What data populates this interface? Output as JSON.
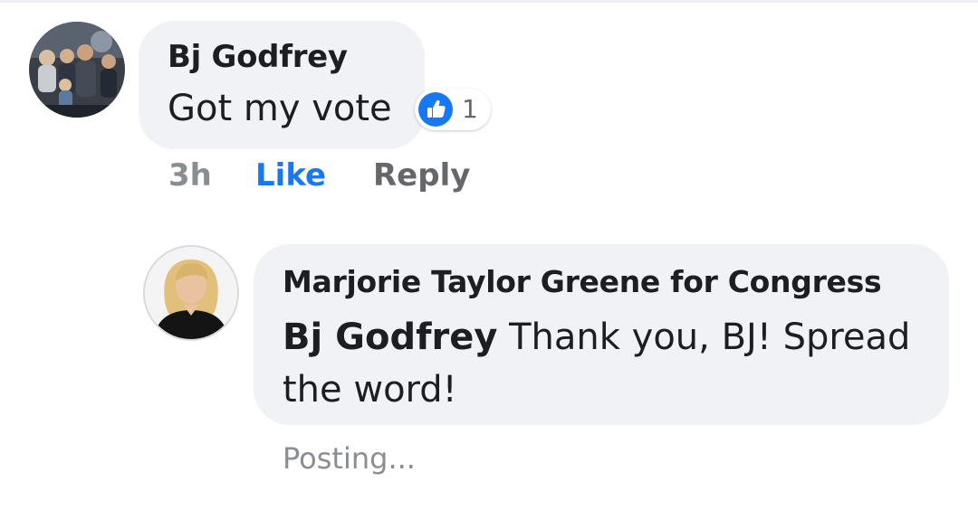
{
  "comments": [
    {
      "author": "Bj Godfrey",
      "text": "Got my vote",
      "reaction_count": "1",
      "reaction_icon": "like-icon",
      "time": "3h",
      "actions": {
        "like_label": "Like",
        "reply_label": "Reply"
      }
    }
  ],
  "reply": {
    "author": "Marjorie Taylor Greene for Congress",
    "mention": "Bj Godfrey",
    "text": "Thank you, BJ! Spread the word!",
    "status": "Posting..."
  },
  "colors": {
    "accent_blue": "#1877f2",
    "bubble_bg": "#f0f2f5",
    "meta_gray": "#8a8d91"
  }
}
